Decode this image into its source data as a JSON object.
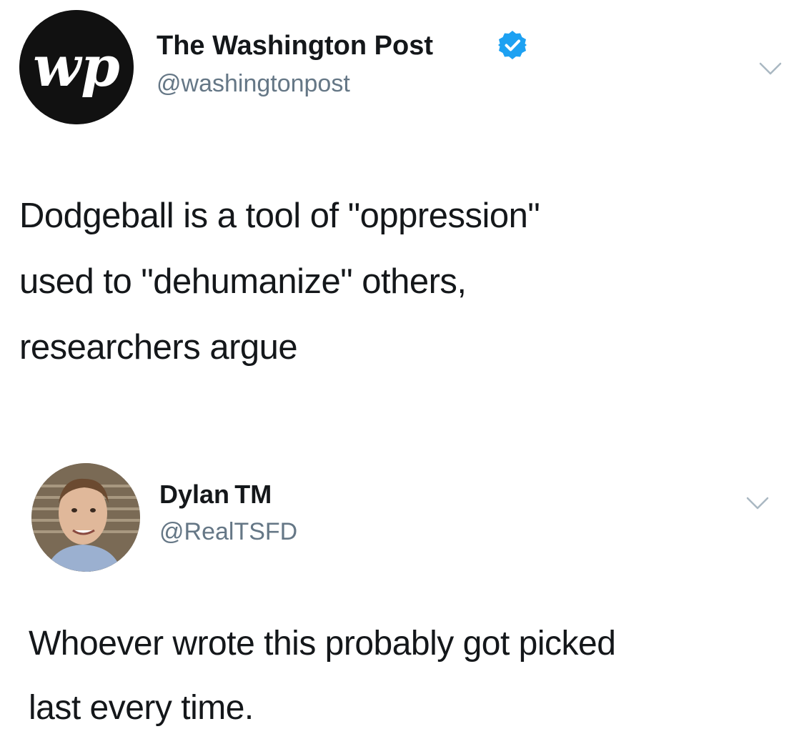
{
  "tweets": [
    {
      "display_name": "The Washington Post",
      "handle": "@washingtonpost",
      "avatar_monogram": "wp",
      "verified": true,
      "text_lines": [
        "Dodgeball is a tool of \"oppression\"",
        "used to \"dehumanize\" others,",
        "researchers argue"
      ]
    },
    {
      "display_name": "Dylan TM",
      "handle": "@RealTSFD",
      "verified": false,
      "text_lines": [
        "Whoever wrote this probably got picked",
        "last every time."
      ]
    }
  ],
  "colors": {
    "text": "#14171a",
    "secondary": "#657786",
    "verified_blue": "#1da1f2",
    "chevron": "#aab8c2"
  },
  "icons": {
    "verified": "verified-badge-icon",
    "more": "chevron-down-icon"
  }
}
